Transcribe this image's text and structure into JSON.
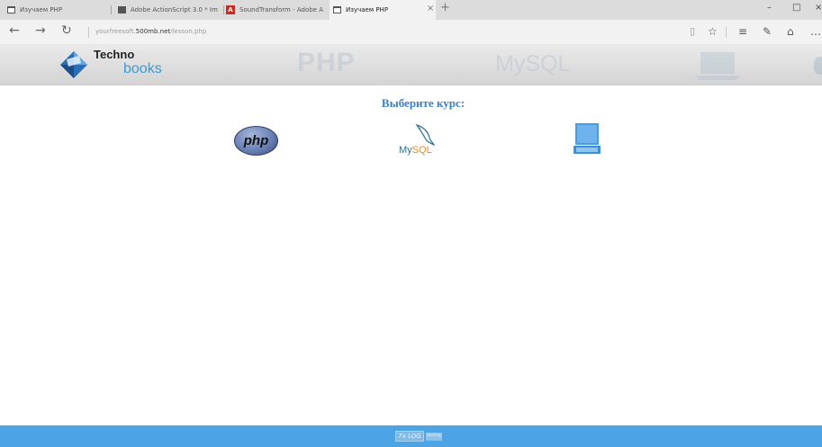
{
  "browser": {
    "tabs": [
      {
        "title": "Изучаем PHP",
        "icon": "page-icon"
      },
      {
        "title": "Adobe ActionScript 3.0 * Im",
        "icon": "square-icon"
      },
      {
        "title": "SoundTransform - Adobe A",
        "icon": "adobe-icon",
        "icon_text": "A"
      },
      {
        "title": "Изучаем PHP",
        "icon": "page-icon",
        "active": true
      }
    ],
    "new_tab": "+",
    "close_tab": "×",
    "window_buttons": {
      "minimize": "–",
      "maximize": "□",
      "close": "×"
    },
    "nav": {
      "back": "←",
      "forward": "→",
      "refresh": "↻"
    },
    "url": {
      "prefix": "yourfreesoft.",
      "domain": "500mb.net",
      "path": "/lesson.php"
    },
    "toolbar": {
      "reading_view": "▯",
      "favorite": "☆",
      "hub": "≡",
      "note": "✎",
      "share": "⌂",
      "more": "…"
    }
  },
  "site": {
    "logo": {
      "top": "Techno",
      "bottom": "books"
    },
    "watermarks": {
      "php": "PHP",
      "mysql": "MySQL"
    },
    "heading": "Выберите курс:",
    "courses": [
      {
        "name": "php",
        "label": "php",
        "icon": "php-logo-icon"
      },
      {
        "name": "mysql",
        "label_part1": "My",
        "label_part2": "SQL",
        "icon": "mysql-logo-icon"
      },
      {
        "name": "computer",
        "icon": "laptop-icon"
      }
    ],
    "footer": {
      "badge": "7x LOG",
      "badge_small": "Hosting"
    }
  },
  "colors": {
    "accent": "#3a7fc6",
    "footer": "#4da4e4",
    "header_bg": "#dedede"
  }
}
